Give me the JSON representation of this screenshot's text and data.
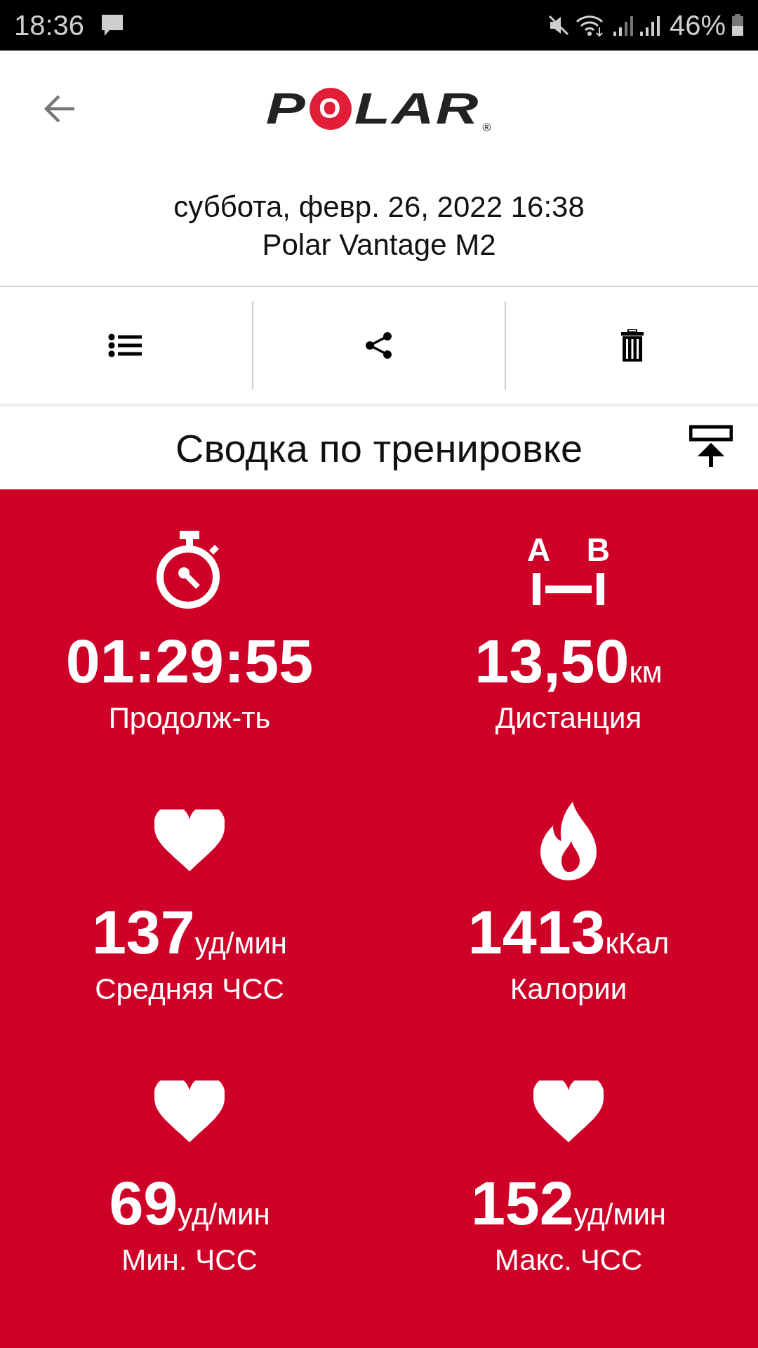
{
  "status_bar": {
    "time": "18:36",
    "battery": "46%"
  },
  "header": {
    "logo": {
      "letters": [
        {
          "char": "P",
          "kind": "plain"
        },
        {
          "char": "O",
          "kind": "disc"
        },
        {
          "char": "L",
          "kind": "plain"
        },
        {
          "char": "A",
          "kind": "plain"
        },
        {
          "char": "R",
          "kind": "plain"
        }
      ],
      "mark": "®"
    },
    "date": "суббота, февр. 26, 2022 16:38",
    "device": "Polar Vantage M2"
  },
  "toolbar": [
    {
      "kind": "list"
    },
    {
      "kind": "share"
    },
    {
      "kind": "delete"
    }
  ],
  "section_title": "Сводка по тренировке",
  "distance_icon": {
    "letters": [
      "A",
      "B"
    ]
  },
  "metrics": [
    {
      "kind": "stopwatch",
      "value": "01:29:55",
      "label": "Продолж-ть"
    },
    {
      "kind": "distance",
      "value": "13,50",
      "unit": "км",
      "label": "Дистанция"
    },
    {
      "kind": "heart",
      "value": "137",
      "unit": "уд/мин",
      "label": "Средняя ЧСС"
    },
    {
      "kind": "flame",
      "value": "1413",
      "unit": "кКал",
      "label": "Калории"
    },
    {
      "kind": "heart",
      "value": "69",
      "unit": "уд/мин",
      "label": "Мин. ЧСС"
    },
    {
      "kind": "heart",
      "value": "152",
      "unit": "уд/мин",
      "label": "Макс. ЧСС"
    }
  ]
}
